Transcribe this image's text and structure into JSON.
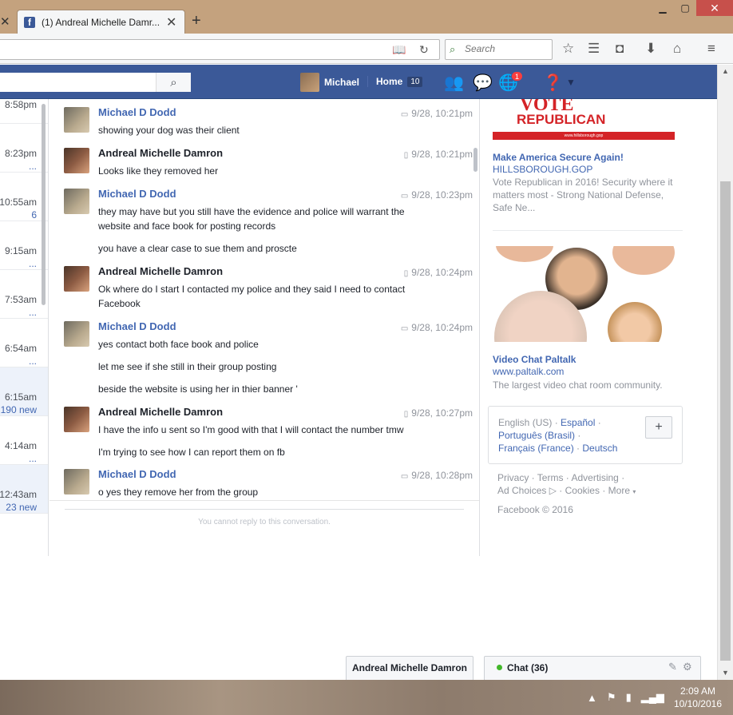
{
  "browser": {
    "tab_title": "(1) Andreal Michelle Damr...",
    "search_placeholder": "Search"
  },
  "fb": {
    "user_name": "Michael",
    "home_label": "Home",
    "home_count": "10",
    "notification_count": "1"
  },
  "threads": [
    {
      "time": "8:58pm",
      "sub": ""
    },
    {
      "time": "8:23pm",
      "sub": "..."
    },
    {
      "time": "10:55am",
      "sub": "6"
    },
    {
      "time": "9:15am",
      "sub": "..."
    },
    {
      "time": "7:53am",
      "sub": "..."
    },
    {
      "time": "6:54am",
      "sub": "..."
    },
    {
      "time": "6:15am",
      "sub": "190 new"
    },
    {
      "time": "4:14am",
      "sub": "..."
    },
    {
      "time": "12:43am",
      "sub": "23 new"
    }
  ],
  "messages": [
    {
      "author": "Michael D Dodd",
      "time": "9/28, 10:21pm",
      "lines": [
        "showing your dog was their client"
      ]
    },
    {
      "author": "Andreal Michelle Damron",
      "time": "9/28, 10:21pm",
      "lines": [
        "Looks like they removed her"
      ]
    },
    {
      "author": "Michael D Dodd",
      "time": "9/28, 10:23pm",
      "lines": [
        "they  may have but you still have the evidence and  police will  warrant the website and face book for posting records",
        "you have a clear case to sue them and proscte"
      ]
    },
    {
      "author": "Andreal Michelle Damron",
      "time": "9/28, 10:24pm",
      "lines": [
        "Ok where do I start I contacted my police and they said I need to contact Facebook"
      ]
    },
    {
      "author": "Michael D Dodd",
      "time": "9/28, 10:24pm",
      "lines": [
        "yes contact both face book and police",
        "let  me see if  she still in their group posting",
        "beside the website  is using her in thier banner '"
      ]
    },
    {
      "author": "Andreal Michelle Damron",
      "time": "9/28, 10:27pm",
      "lines": [
        "I have the info u sent so I'm good with that I will contact the number tmw",
        "I'm trying to see how I can report them on fb"
      ]
    },
    {
      "author": "Michael D Dodd",
      "time": "9/28, 10:28pm",
      "lines": [
        "o yes they remove her from the group"
      ]
    }
  ],
  "reply_notice": "You cannot reply to this conversation.",
  "ads": {
    "vote": {
      "banner_line1": "VOTE",
      "banner_line2": "REPUBLICAN",
      "banner_url": "www.hillsborough.gop",
      "title": "Make America Secure Again!",
      "domain": "HILLSBOROUGH.GOP",
      "desc": "Vote Republican in 2016! Security where it matters most - Strong National Defense, Safe Ne..."
    },
    "paltalk": {
      "title": "Video Chat Paltalk",
      "domain": "www.paltalk.com",
      "desc": "The largest video chat room community."
    }
  },
  "languages": {
    "current": "English (US)",
    "row1_link": "Español",
    "row2_link": "Português (Brasil)",
    "row3_link_a": "Français (France)",
    "row3_link_b": "Deutsch",
    "add_label": "+"
  },
  "footer": {
    "privacy": "Privacy",
    "terms": "Terms",
    "advertising": "Advertising",
    "ad_choices": "Ad Choices",
    "cookies": "Cookies",
    "more": "More",
    "copyright": "Facebook © 2016"
  },
  "chat": {
    "tab_name": "Andreal Michelle Damron",
    "chat_label": "Chat (36)"
  },
  "taskbar": {
    "time": "2:09 AM",
    "date": "10/10/2016"
  }
}
